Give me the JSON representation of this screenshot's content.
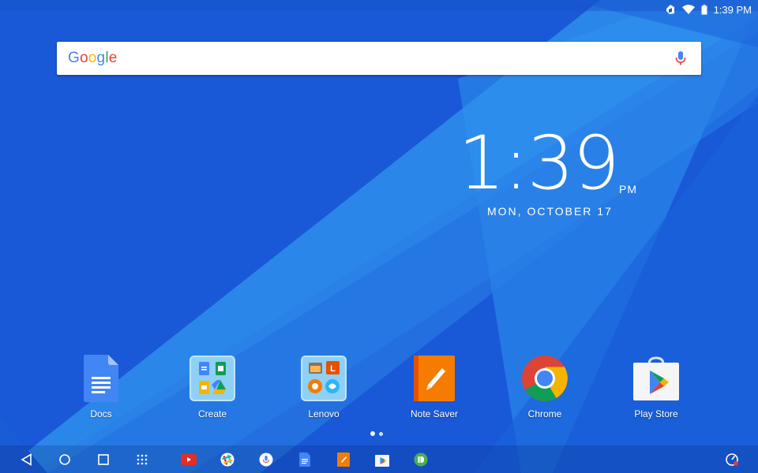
{
  "status_bar": {
    "time": "1:39 PM",
    "icons": [
      "notification-icon",
      "wifi-icon",
      "battery-icon"
    ]
  },
  "search": {
    "logo_text": "Google",
    "icon": "mic-icon"
  },
  "clock": {
    "time": "1:39",
    "ampm": "PM",
    "date": "MON, OCTOBER 17"
  },
  "apps": [
    {
      "label": "Docs",
      "icon": "docs-icon"
    },
    {
      "label": "Create",
      "icon": "folder-create-icon"
    },
    {
      "label": "Lenovo",
      "icon": "folder-lenovo-icon"
    },
    {
      "label": "Note Saver",
      "icon": "note-saver-icon"
    },
    {
      "label": "Chrome",
      "icon": "chrome-icon"
    },
    {
      "label": "Play Store",
      "icon": "play-store-icon"
    }
  ],
  "page_indicator": {
    "pages": 2,
    "current": 1
  },
  "nav_bar": {
    "buttons": [
      "back-icon",
      "home-icon",
      "recents-icon",
      "app-drawer-icon"
    ],
    "dock": [
      "youtube-icon",
      "slack-icon",
      "voice-search-icon",
      "docs-icon",
      "note-saver-icon",
      "play-store-icon",
      "pushbullet-icon"
    ],
    "right": "speed-icon"
  },
  "colors": {
    "wallpaper_dark": "#1857d6",
    "wallpaper_light": "#2a8ae8",
    "accent_stripe": "#3aa6f2"
  }
}
